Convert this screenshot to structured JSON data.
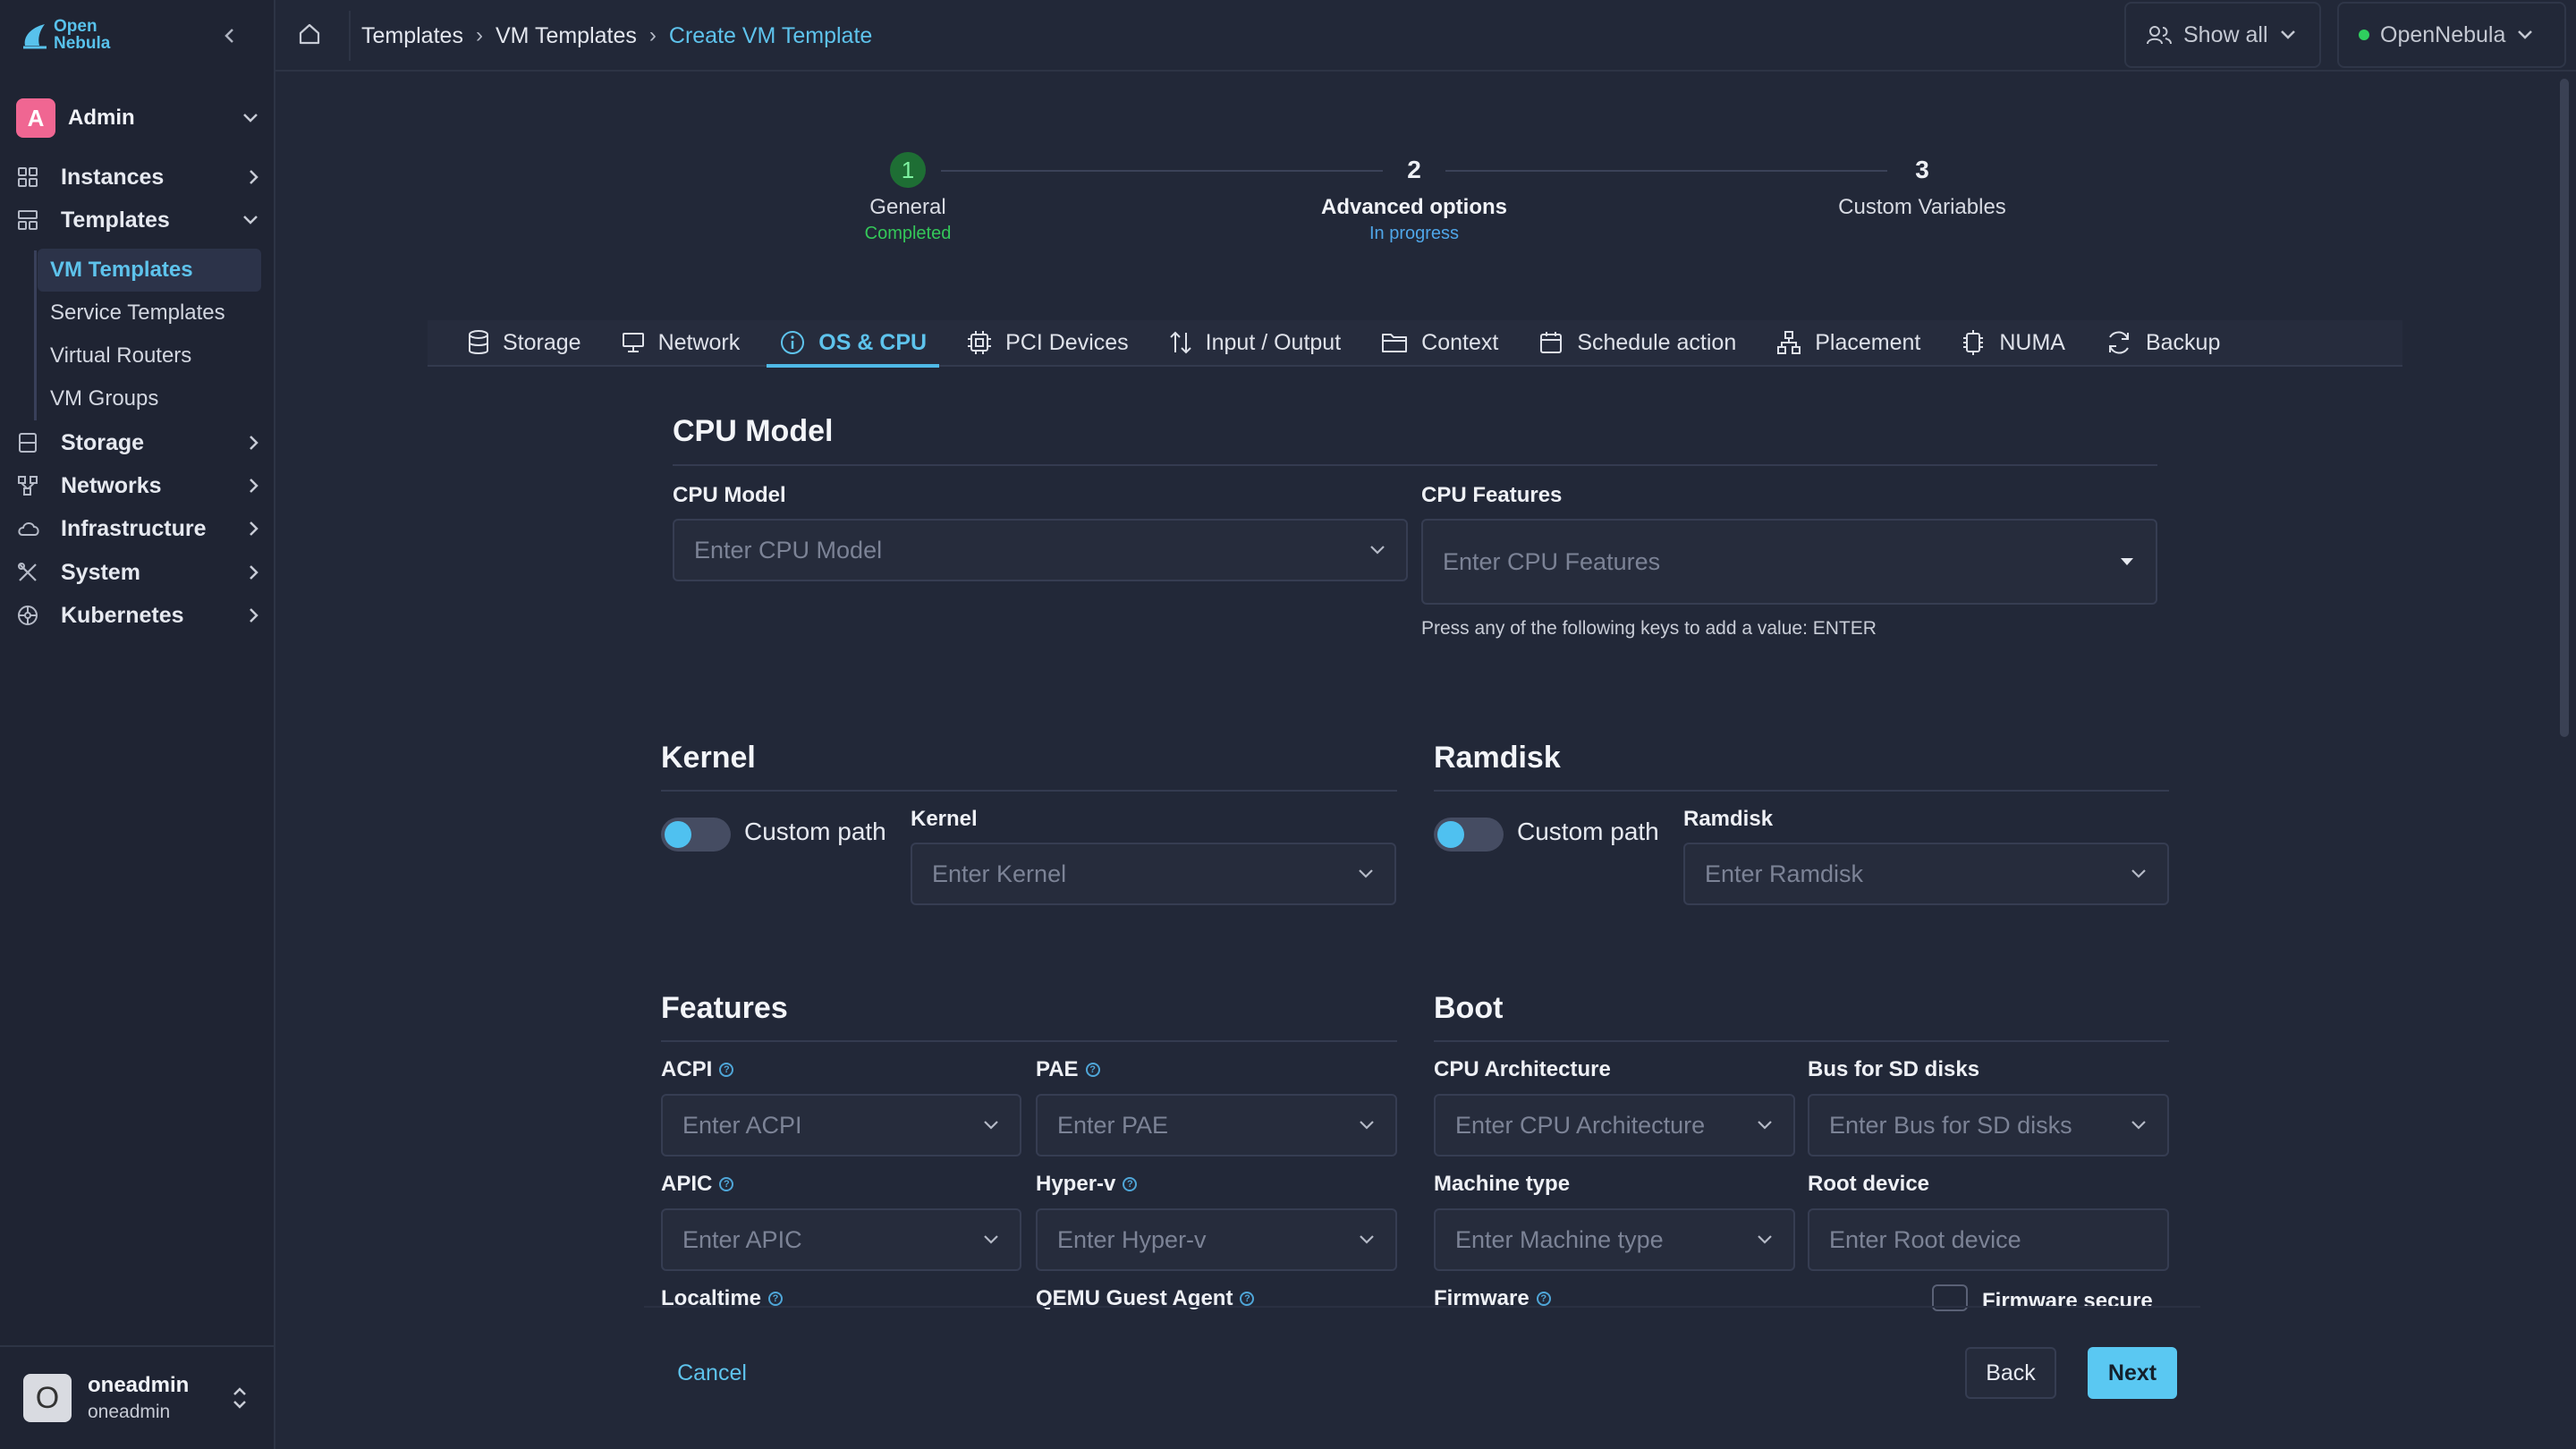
{
  "app": {
    "logo_line1": "Open",
    "logo_line2": "Nebula"
  },
  "sidebar": {
    "user": {
      "initial": "A",
      "name": "Admin"
    },
    "items": [
      {
        "label": "Instances"
      },
      {
        "label": "Templates"
      },
      {
        "label": "Storage"
      },
      {
        "label": "Networks"
      },
      {
        "label": "Infrastructure"
      },
      {
        "label": "System"
      },
      {
        "label": "Kubernetes"
      }
    ],
    "template_subitems": [
      {
        "label": "VM Templates"
      },
      {
        "label": "Service Templates"
      },
      {
        "label": "Virtual Routers"
      },
      {
        "label": "VM Groups"
      }
    ],
    "bottom_user": {
      "initial": "O",
      "name": "oneadmin",
      "group": "oneadmin"
    }
  },
  "topbar": {
    "breadcrumb": [
      "Templates",
      "VM Templates",
      "Create VM Template"
    ],
    "show_all_label": "Show all",
    "zone_label": "OpenNebula"
  },
  "stepper": [
    {
      "number": "1",
      "label": "General",
      "status": "Completed",
      "status_color": "#34c759"
    },
    {
      "number": "2",
      "label": "Advanced options",
      "status": "In progress",
      "status_color": "#4fa6e8"
    },
    {
      "number": "3",
      "label": "Custom Variables",
      "status": ""
    }
  ],
  "tabs": [
    {
      "label": "Storage",
      "icon": "database-icon"
    },
    {
      "label": "Network",
      "icon": "monitor-icon"
    },
    {
      "label": "OS & CPU",
      "icon": "info-icon"
    },
    {
      "label": "PCI Devices",
      "icon": "chip-icon"
    },
    {
      "label": "Input / Output",
      "icon": "arrows-updown-icon"
    },
    {
      "label": "Context",
      "icon": "folder-icon"
    },
    {
      "label": "Schedule action",
      "icon": "calendar-icon"
    },
    {
      "label": "Placement",
      "icon": "hierarchy-icon"
    },
    {
      "label": "NUMA",
      "icon": "cpu-icon"
    },
    {
      "label": "Backup",
      "icon": "refresh-icon"
    }
  ],
  "cpu_model": {
    "title": "CPU Model",
    "model_label": "CPU Model",
    "model_placeholder": "Enter CPU Model",
    "features_label": "CPU Features",
    "features_placeholder": "Enter CPU Features",
    "features_hint": "Press any of the following keys to add a value: ENTER"
  },
  "kernel": {
    "title": "Kernel",
    "toggle_label": "Custom path",
    "field_label": "Kernel",
    "placeholder": "Enter Kernel"
  },
  "ramdisk": {
    "title": "Ramdisk",
    "toggle_label": "Custom path",
    "field_label": "Ramdisk",
    "placeholder": "Enter Ramdisk"
  },
  "features": {
    "title": "Features",
    "acpi_label": "ACPI",
    "acpi_placeholder": "Enter ACPI",
    "pae_label": "PAE",
    "pae_placeholder": "Enter PAE",
    "apic_label": "APIC",
    "apic_placeholder": "Enter APIC",
    "hyperv_label": "Hyper-v",
    "hyperv_placeholder": "Enter Hyper-v",
    "localtime_label": "Localtime",
    "qemu_label": "QEMU Guest Agent"
  },
  "boot": {
    "title": "Boot",
    "arch_label": "CPU Architecture",
    "arch_placeholder": "Enter CPU Architecture",
    "bus_label": "Bus for SD disks",
    "bus_placeholder": "Enter Bus for SD disks",
    "machine_label": "Machine type",
    "machine_placeholder": "Enter Machine type",
    "root_label": "Root device",
    "root_placeholder": "Enter Root device",
    "firmware_label": "Firmware",
    "firmware_secure_label": "Firmware secure"
  },
  "footer": {
    "cancel": "Cancel",
    "back": "Back",
    "next": "Next"
  }
}
